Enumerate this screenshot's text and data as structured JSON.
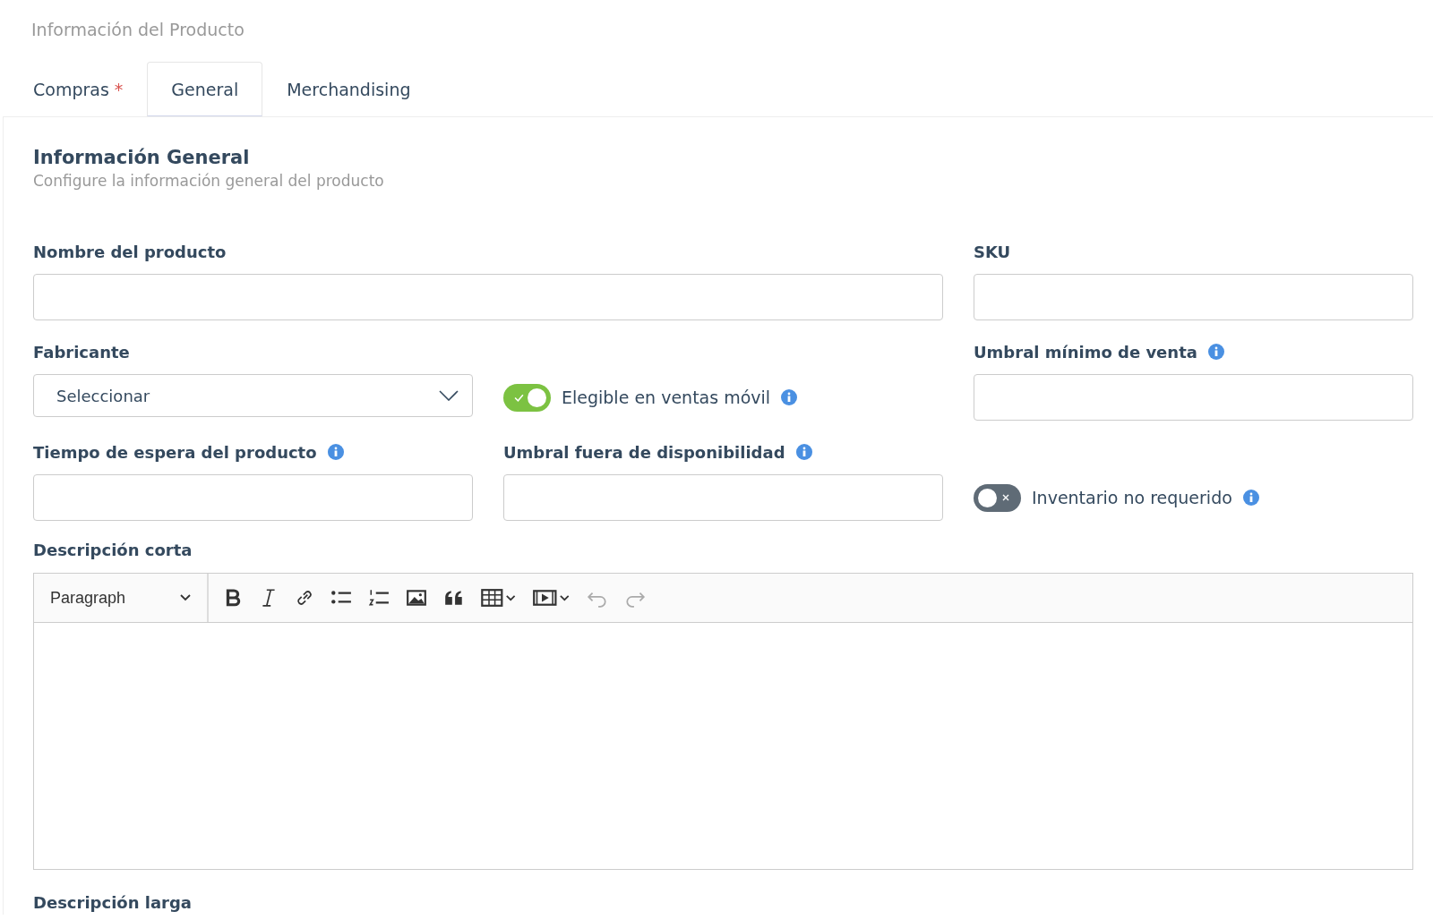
{
  "page_title": "Información del Producto",
  "tabs": [
    {
      "label": "Compras",
      "marker": "*",
      "selected": false
    },
    {
      "label": "General",
      "selected": true
    },
    {
      "label": "Merchandising",
      "selected": false
    }
  ],
  "section": {
    "title": "Información General",
    "subtitle": "Configure la información general del producto"
  },
  "rows": [
    [
      {
        "kind": "text",
        "label": "Nombre del producto",
        "info": false
      },
      {
        "kind": "text",
        "label": "SKU",
        "info": false
      }
    ],
    [
      {
        "kind": "select",
        "label": "Fabricante",
        "value": "Seleccionar",
        "info": false
      },
      {
        "kind": "toggle",
        "label": "Elegible en ventas móvil",
        "on": true,
        "info": true
      },
      {
        "kind": "text",
        "label": "Umbral mínimo de venta",
        "info": true
      }
    ],
    [
      {
        "kind": "text",
        "label": "Tiempo de espera del producto",
        "info": true
      },
      {
        "kind": "text",
        "label": "Umbral fuera de disponibilidad",
        "info": true
      },
      {
        "kind": "toggle",
        "label": "Inventario no requerido",
        "on": false,
        "info": true
      }
    ]
  ],
  "editors": [
    {
      "label": "Descripción corta",
      "format": "Paragraph",
      "toolbar": [
        {
          "kind": "bold",
          "disabled": false
        },
        {
          "kind": "italic",
          "disabled": false
        },
        {
          "kind": "link",
          "disabled": false
        },
        {
          "kind": "bullets",
          "disabled": false
        },
        {
          "kind": "numbers",
          "disabled": false
        },
        {
          "kind": "image",
          "disabled": false
        },
        {
          "kind": "quote",
          "disabled": false
        },
        {
          "kind": "table",
          "disabled": false
        },
        {
          "kind": "media",
          "disabled": false
        },
        {
          "kind": "undo",
          "disabled": true
        },
        {
          "kind": "redo",
          "disabled": true
        }
      ]
    },
    {
      "label": "Descripción larga"
    }
  ]
}
